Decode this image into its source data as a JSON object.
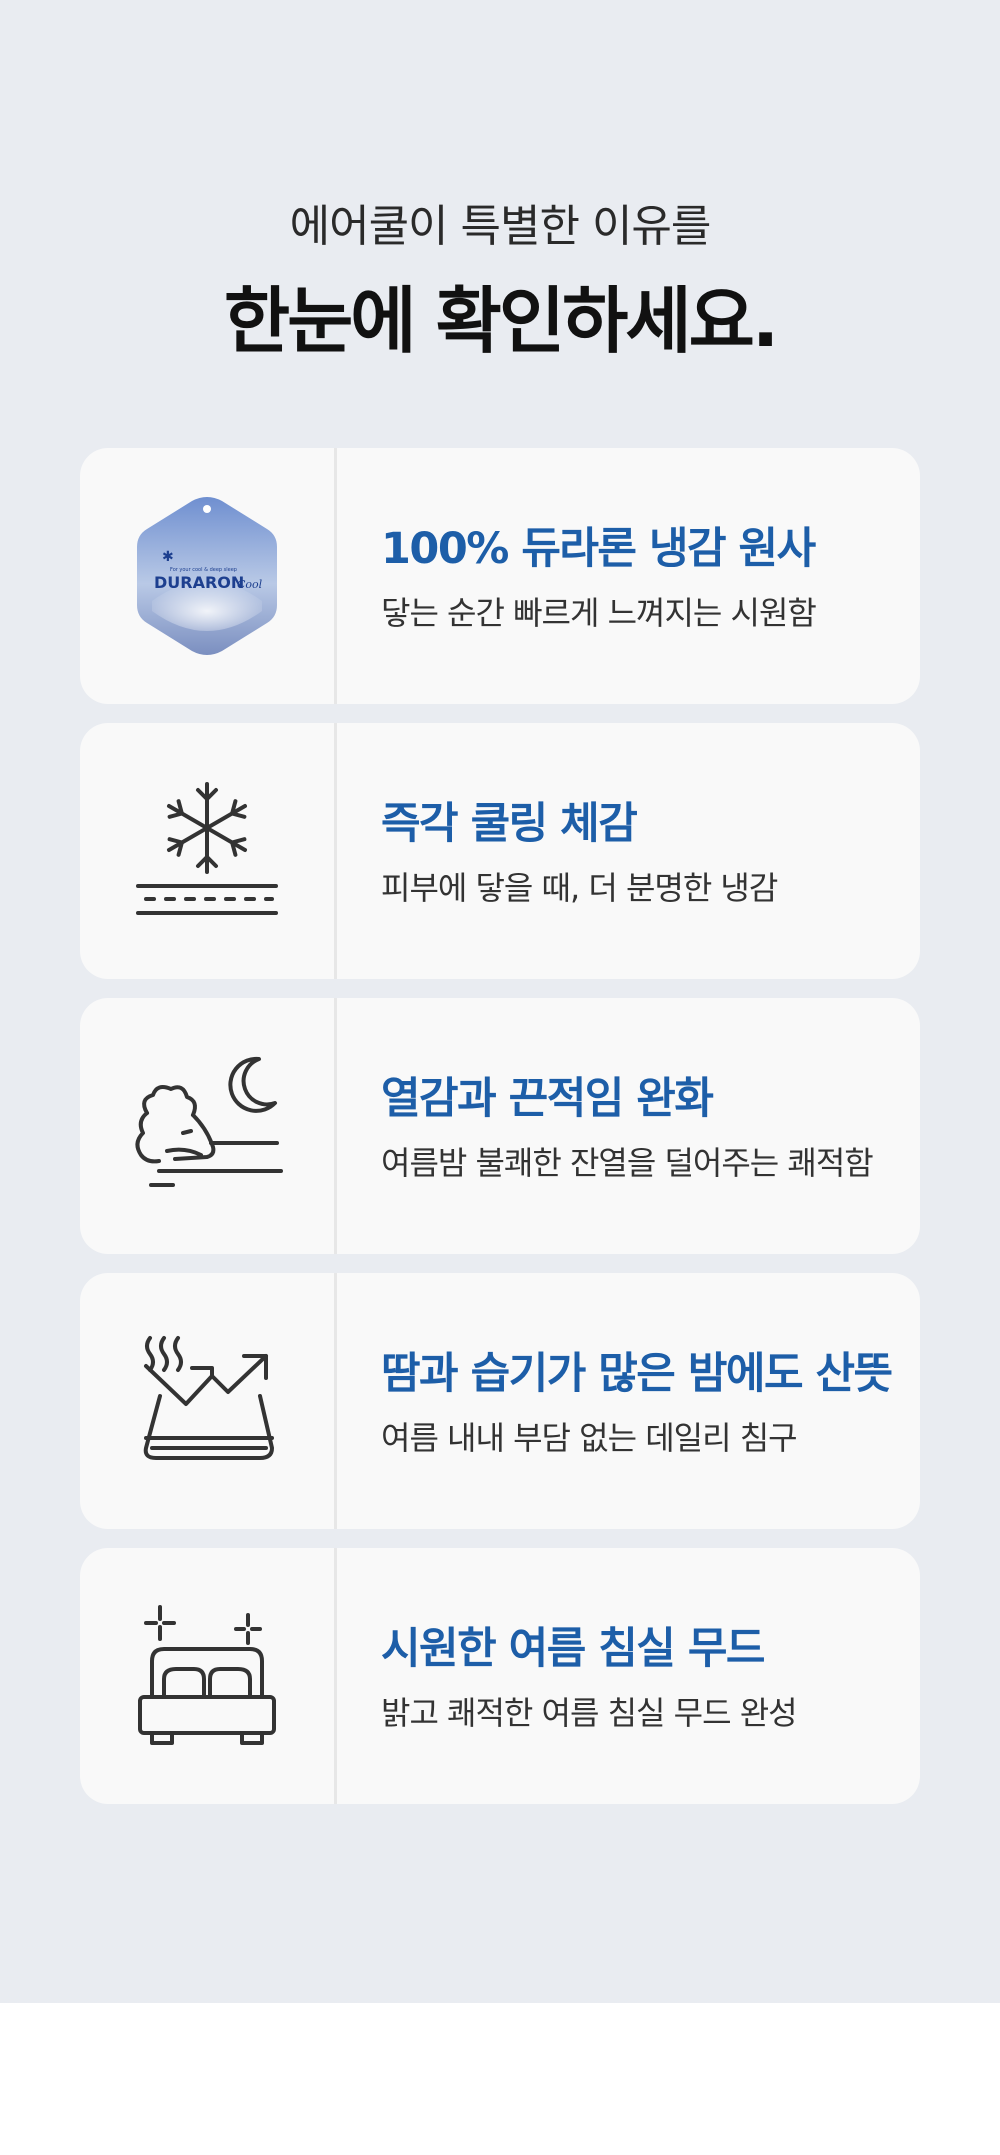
{
  "header": {
    "subtitle": "에어쿨이 특별한 이유를",
    "title": "한눈에 확인하세요."
  },
  "features": [
    {
      "icon": "duraron-tag-icon",
      "title": "100% 듀라론 냉감 원사",
      "desc": "닿는 순간 빠르게 느껴지는 시원함",
      "tag_brand": "DURARON",
      "tag_script": "Cool",
      "tag_tagline": "For your cool & deep sleep"
    },
    {
      "icon": "snowflake-surface-icon",
      "title": "즉각 쿨링 체감",
      "desc": "피부에 닿을 때, 더 분명한 냉감"
    },
    {
      "icon": "sleeping-moon-icon",
      "title": "열감과 끈적임 완화",
      "desc": "여름밤 불쾌한 잔열을 덜어주는 쾌적함"
    },
    {
      "icon": "moisture-release-icon",
      "title": "땀과 습기가 많은 밤에도 산뜻",
      "desc": "여름 내내 부담 없는 데일리 침구"
    },
    {
      "icon": "bed-sparkle-icon",
      "title": "시원한 여름 침실 무드",
      "desc": "밝고 쾌적한 여름 침실 무드 완성"
    }
  ],
  "colors": {
    "background": "#e9ecf1",
    "card": "#f9f9f9",
    "title_blue": "#1d5ea8",
    "icon_stroke": "#333333"
  }
}
